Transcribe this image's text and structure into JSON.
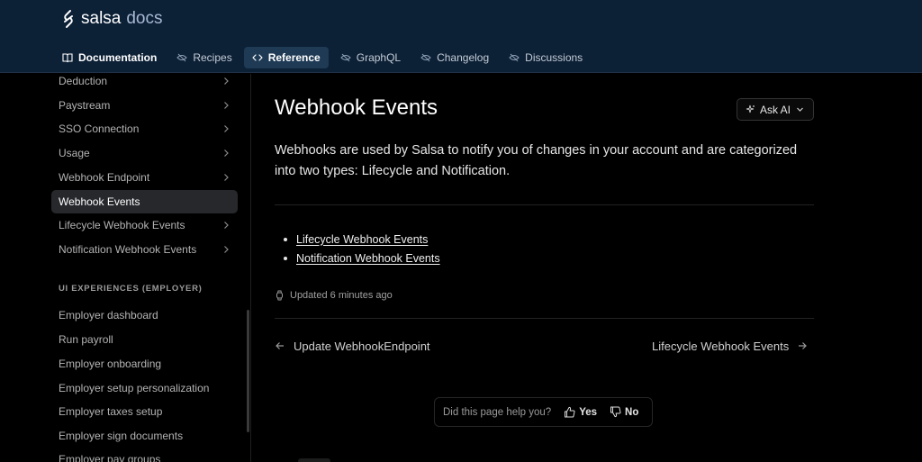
{
  "brand": {
    "name": "salsa",
    "suffix": "docs"
  },
  "nav": {
    "tabs": [
      {
        "label": "Documentation",
        "icon": "book-icon"
      },
      {
        "label": "Recipes",
        "icon": "eye-off-icon"
      },
      {
        "label": "Reference",
        "icon": "code-icon"
      },
      {
        "label": "GraphQL",
        "icon": "eye-off-icon"
      },
      {
        "label": "Changelog",
        "icon": "eye-off-icon"
      },
      {
        "label": "Discussions",
        "icon": "eye-off-icon"
      }
    ],
    "active": "Reference"
  },
  "sidebar": {
    "items": [
      {
        "label": "Deduction"
      },
      {
        "label": "Paystream"
      },
      {
        "label": "SSO Connection"
      },
      {
        "label": "Usage"
      },
      {
        "label": "Webhook Endpoint"
      },
      {
        "label": "Webhook Events"
      },
      {
        "label": "Lifecycle Webhook Events"
      },
      {
        "label": "Notification Webhook Events"
      }
    ],
    "active": "Webhook Events",
    "section_title": "UI EXPERIENCES (EMPLOYER)",
    "section_items": [
      {
        "label": "Employer dashboard"
      },
      {
        "label": "Run payroll"
      },
      {
        "label": "Employer onboarding"
      },
      {
        "label": "Employer setup personalization"
      },
      {
        "label": "Employer taxes setup"
      },
      {
        "label": "Employer sign documents"
      },
      {
        "label": "Employer pay groups"
      }
    ]
  },
  "main": {
    "title": "Webhook Events",
    "ask_ai_label": "Ask AI",
    "intro": "Webhooks are used by Salsa to notify you of changes in your account and are categorized into two types: Lifecycle and Notification.",
    "links": [
      {
        "label": "Lifecycle Webhook Events"
      },
      {
        "label": "Notification Webhook Events"
      }
    ],
    "updated": "Updated 6 minutes ago",
    "prev_label": "Update WebhookEndpoint",
    "next_label": "Lifecycle Webhook Events",
    "feedback": {
      "question": "Did this page help you?",
      "yes": "Yes",
      "no": "No"
    }
  },
  "colors": {
    "header_bg": "#0c2036",
    "active_tab_bg": "#1e3a55",
    "page_bg": "#000000",
    "sidebar_active_bg": "#26282c",
    "brand_suffix": "#a8b9d4"
  }
}
